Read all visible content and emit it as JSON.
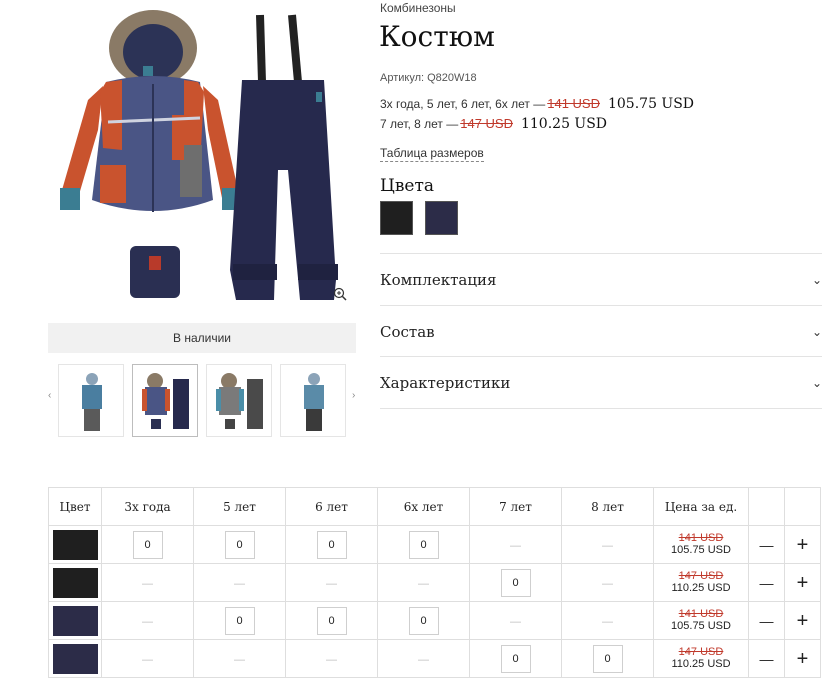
{
  "breadcrumb": "Комбинезоны",
  "title": "Костюм",
  "sku_label": "Артикул: Q820W18",
  "prices": [
    {
      "sizes": "3х года, 5 лет, 6 лет, 6х лет —",
      "old": "141 USD",
      "new": "105.75 USD"
    },
    {
      "sizes": "7 лет, 8 лет —",
      "old": "147 USD",
      "new": "110.25 USD"
    }
  ],
  "size_table_link": "Таблица размеров",
  "colors_title": "Цвета",
  "colors": [
    "#1f1f1f",
    "#2c2c48"
  ],
  "accordion": [
    {
      "label": "Комплектация",
      "icon": "chevron-down-icon"
    },
    {
      "label": "Состав",
      "icon": "chevron-down-icon"
    },
    {
      "label": "Характеристики",
      "icon": "chevron-down-icon"
    }
  ],
  "stock_status": "В наличии",
  "icons": {
    "prev": "‹",
    "next": "›",
    "chevron": "⌄",
    "minus": "—",
    "plus": "+"
  },
  "table": {
    "headers": [
      "Цвет",
      "3х года",
      "5 лет",
      "6 лет",
      "6х лет",
      "7 лет",
      "8 лет",
      "Цена за ед."
    ],
    "rows": [
      {
        "color": "#1f1f1f",
        "cells": [
          "0",
          "0",
          "0",
          "0",
          null,
          null
        ],
        "old": "141 USD",
        "new": "105.75 USD"
      },
      {
        "color": "#1f1f1f",
        "cells": [
          null,
          null,
          null,
          null,
          "0",
          null
        ],
        "old": "147 USD",
        "new": "110.25 USD"
      },
      {
        "color": "#2c2c48",
        "cells": [
          null,
          "0",
          "0",
          "0",
          null,
          null
        ],
        "old": "141 USD",
        "new": "105.75 USD"
      },
      {
        "color": "#2c2c48",
        "cells": [
          null,
          null,
          null,
          null,
          "0",
          "0"
        ],
        "old": "147 USD",
        "new": "110.25 USD"
      }
    ],
    "dash": "—"
  }
}
